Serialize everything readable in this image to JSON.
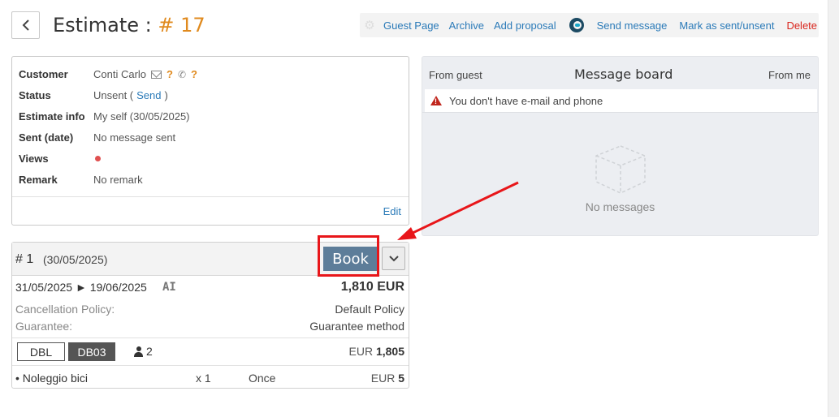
{
  "header": {
    "back_icon": "chevron-left-icon",
    "title_prefix": "Estimate : ",
    "title_number": "# 17"
  },
  "toolbar": {
    "guest_page": "Guest Page",
    "archive": "Archive",
    "add_proposal": "Add proposal",
    "send_message": "Send message",
    "mark_sent": "Mark as sent/unsent",
    "delete": "Delete"
  },
  "info": {
    "customer_label": "Customer",
    "customer_value": "Conti Carlo",
    "customer_q1": "?",
    "customer_q2": "?",
    "status_label": "Status",
    "status_value_pre": "Unsent (",
    "status_send": "Send",
    "status_value_post": ")",
    "estimate_info_label": "Estimate info",
    "estimate_info_value": "My self (30/05/2025)",
    "sent_label": "Sent (date)",
    "sent_value": "No message sent",
    "views_label": "Views",
    "remark_label": "Remark",
    "remark_value": "No remark",
    "edit": "Edit"
  },
  "proposal": {
    "number": "# 1",
    "date": "(30/05/2025)",
    "book_label": "Book",
    "date_from": "31/05/2025",
    "date_arrow": "►",
    "date_to": "19/06/2025",
    "ai_badge": "AI",
    "total": "1,810 EUR",
    "cancellation_label": "Cancellation Policy:",
    "cancellation_value": "Default Policy",
    "guarantee_label": "Guarantee:",
    "guarantee_value": "Guarantee method",
    "room_type": "DBL",
    "room_code": "DB03",
    "guests": "2",
    "room_currency": "EUR",
    "room_amount": "1,805",
    "extra_name": "• Noleggio bici",
    "extra_qty": "x 1",
    "extra_freq": "Once",
    "extra_currency": "EUR",
    "extra_amount": "5"
  },
  "message_board": {
    "from_guest": "From guest",
    "title": "Message board",
    "from_me": "From me",
    "warning": "You don't have e-mail and phone",
    "empty": "No messages"
  },
  "colors": {
    "accent_orange": "#e08a1e",
    "link_blue": "#2a7ab8",
    "danger_red": "#d9251c",
    "book_button": "#5d7d99",
    "annotation_red": "#e8161a"
  }
}
